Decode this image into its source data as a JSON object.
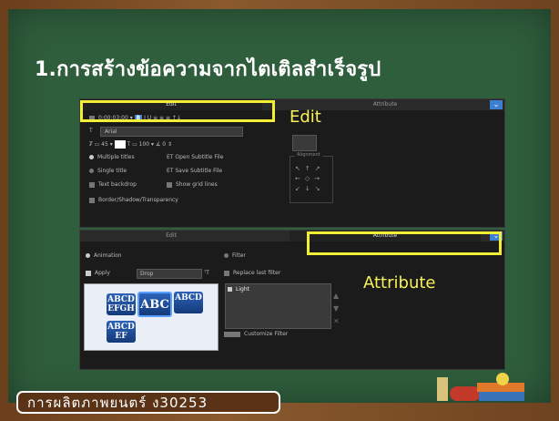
{
  "slide": {
    "title": "1.การสร้างข้อความจากไตเติลสำเร็จรูป",
    "footer": "การผลิตภาพยนตร์ ง30253"
  },
  "callouts": {
    "edit": "Edit",
    "attribute": "Attribute"
  },
  "panel_top": {
    "tab_edit": "Edit",
    "tab_attribute": "Attribute",
    "time": "0:00:03:00",
    "font": "Arial",
    "multiple_titles": "Multiple titles",
    "single_title": "Single title",
    "text_backdrop": "Text backdrop",
    "open_subtitle": "Open Subtitle File",
    "save_subtitle": "Save Subtitle File",
    "show_grid": "Show grid lines",
    "border": "Border/Shadow/Transparency",
    "alignment": "Alignment"
  },
  "panel_bottom": {
    "tab_edit": "Edit",
    "tab_attribute": "Attribute",
    "animation": "Animation",
    "filter": "Filter",
    "apply": "Apply",
    "drop": "Drop",
    "replace_last_filter": "Replace last filter",
    "light": "Light",
    "customize_filter": "Customize Filter",
    "tile1": "ABCD EFGH",
    "tile2": "ABC",
    "tile3": "ABCD",
    "tile4": "ABCD EF"
  },
  "colors": {
    "highlight": "#f2ef35",
    "board": "#2f5e3c",
    "frame": "#7a4a22"
  }
}
